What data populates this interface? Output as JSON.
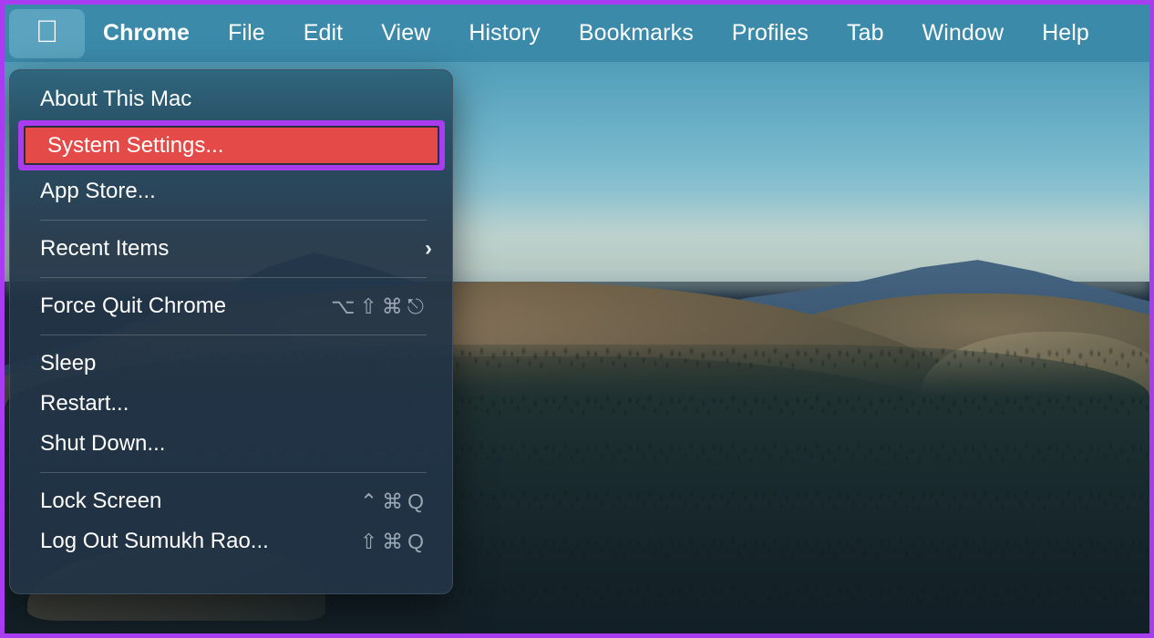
{
  "menubar": {
    "apple_icon": "apple-logo-icon",
    "items": [
      {
        "label": "Chrome",
        "bold": true
      },
      {
        "label": "File",
        "bold": false
      },
      {
        "label": "Edit",
        "bold": false
      },
      {
        "label": "View",
        "bold": false
      },
      {
        "label": "History",
        "bold": false
      },
      {
        "label": "Bookmarks",
        "bold": false
      },
      {
        "label": "Profiles",
        "bold": false
      },
      {
        "label": "Tab",
        "bold": false
      },
      {
        "label": "Window",
        "bold": false
      },
      {
        "label": "Help",
        "bold": false
      }
    ]
  },
  "apple_menu": {
    "items": [
      {
        "label": "About This Mac",
        "shortcut": "",
        "submenu": false,
        "highlighted": false
      },
      {
        "label": "System Settings...",
        "shortcut": "",
        "submenu": false,
        "highlighted": true
      },
      {
        "label": "App Store...",
        "shortcut": "",
        "submenu": false,
        "highlighted": false
      },
      {
        "label": "Recent Items",
        "shortcut": "",
        "submenu": true,
        "highlighted": false
      },
      {
        "label": "Force Quit Chrome",
        "shortcut": "⌥⇧⌘⎋",
        "submenu": false,
        "highlighted": false
      },
      {
        "label": "Sleep",
        "shortcut": "",
        "submenu": false,
        "highlighted": false
      },
      {
        "label": "Restart...",
        "shortcut": "",
        "submenu": false,
        "highlighted": false
      },
      {
        "label": "Shut Down...",
        "shortcut": "",
        "submenu": false,
        "highlighted": false
      },
      {
        "label": "Lock Screen",
        "shortcut": "⌃⌘Q",
        "submenu": false,
        "highlighted": false
      },
      {
        "label": "Log Out Sumukh Rao...",
        "shortcut": "⇧⌘Q",
        "submenu": false,
        "highlighted": false
      }
    ],
    "submenu_chevron": "›"
  },
  "colors": {
    "menubar_bg": "#3b8aaa",
    "menu_bg": "#213446",
    "highlight_red": "#e44b48",
    "annotation_purple": "#a93cf0",
    "text_white": "#ffffff",
    "shortcut_gray": "#9aa7b3"
  }
}
